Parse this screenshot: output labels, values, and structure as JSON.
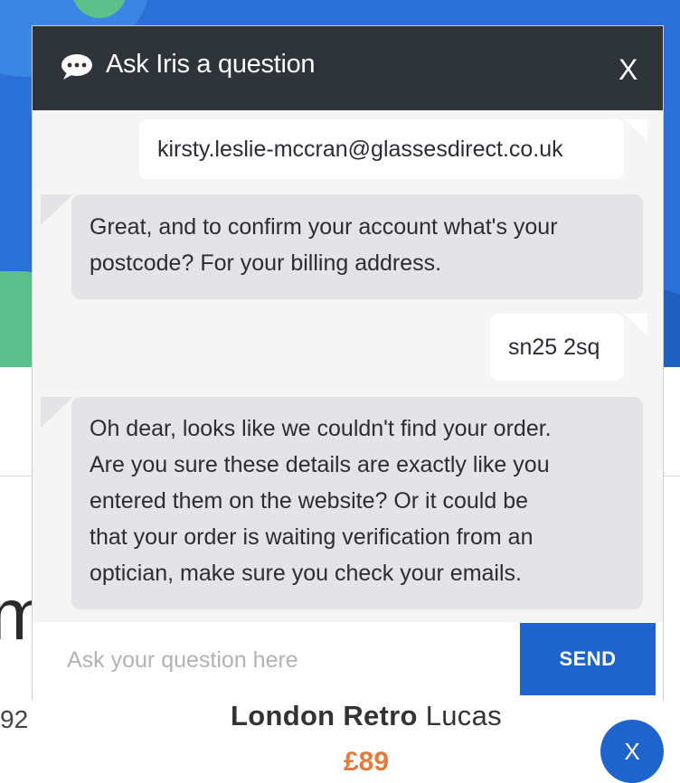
{
  "background": {
    "big_letter": "m",
    "number_fragment": "92",
    "product": {
      "brand": "London Retro",
      "model": "Lucas"
    },
    "price": "£89",
    "close_label": "X"
  },
  "chat": {
    "title": "Ask Iris a question",
    "close_label": "X",
    "messages": [
      {
        "sender": "user",
        "text": "kirsty.leslie-mccran@glassesdirect.co.uk"
      },
      {
        "sender": "bot",
        "lines": [
          "Great, and to confirm your account what's your",
          "postcode? For your billing address."
        ]
      },
      {
        "sender": "user",
        "text": "sn25 2sq"
      },
      {
        "sender": "bot",
        "lines": [
          "Oh dear, looks like we couldn't find your order.",
          "Are you sure these details are exactly like you",
          "entered them on the website? Or it could be",
          "that your order is waiting verification from an",
          "optician, make sure you check your emails."
        ]
      }
    ],
    "input_placeholder": "Ask your question here",
    "send_label": "SEND"
  },
  "colors": {
    "header_bg": "#2f333a",
    "accent_blue": "#1f64cc",
    "bot_bubble": "#e4e4e6",
    "user_bubble": "#ffffff",
    "price_orange": "#e27a3e"
  }
}
